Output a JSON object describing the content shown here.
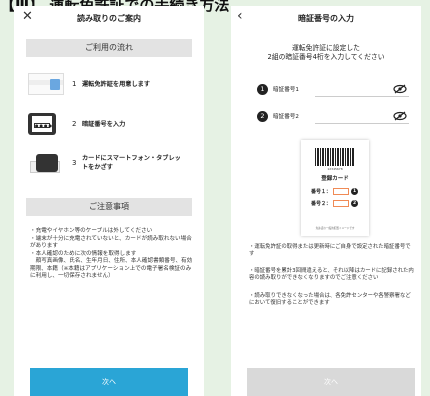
{
  "caption": "【Ⅲ】 運転免許証での手続き方法",
  "left": {
    "title": "読み取りのご案内",
    "flow_header": "ご利用の流れ",
    "steps": [
      {
        "num": "1",
        "text": "運転免許証を用意します"
      },
      {
        "num": "2",
        "text": "暗証番号を入力"
      },
      {
        "num": "3",
        "text": "カードにスマートフォン・タブレットをかざす"
      }
    ],
    "step_phone_dots": "●●●●",
    "notice_header": "ご注意事項",
    "notice_lines": [
      "・充電やイヤホン等のケーブルは外してください",
      "・端末が十分に充電されていないと、カードが読み取れない場合があります",
      "・本人確認のために次の情報を取得します",
      "　顔写真画像、氏名、生年月日、住所、本人確認書類番号、有効期限、本籍（※本籍はアプリケーション上での電子署名検証のみに利用し、一切保存されません）"
    ],
    "next_button": "次へ"
  },
  "right": {
    "title": "暗証番号の入力",
    "instruction_1": "運転免許証に設定した",
    "instruction_2": "2組の暗証番号4桁を入力してください",
    "pins": [
      {
        "num": "1",
        "label": "暗証番号1"
      },
      {
        "num": "2",
        "label": "暗証番号2"
      }
    ],
    "card": {
      "title": "登録カード",
      "barcode_num": "12345678",
      "pin1_label": "番号１：",
      "pin2_label": "番号２：",
      "footer": "免許証の一般的配置イメージです"
    },
    "notes": [
      "・運転免許証の取得または更新時にご自身で設定された暗証番号です",
      "・暗証番号を累計3回間違えると、それ以降はカードに記録された内容の読み取りができなくなりますのでご注意ください",
      "・読み取りできなくなった場合は、各免許センターや各警察署などにおいて復旧することができます"
    ],
    "next_button": "次へ"
  },
  "colors": {
    "background": "#e6f2e4",
    "accent": "#2aa5d6",
    "disabled": "#d9d9d9",
    "pin_box": "#f08a55"
  }
}
